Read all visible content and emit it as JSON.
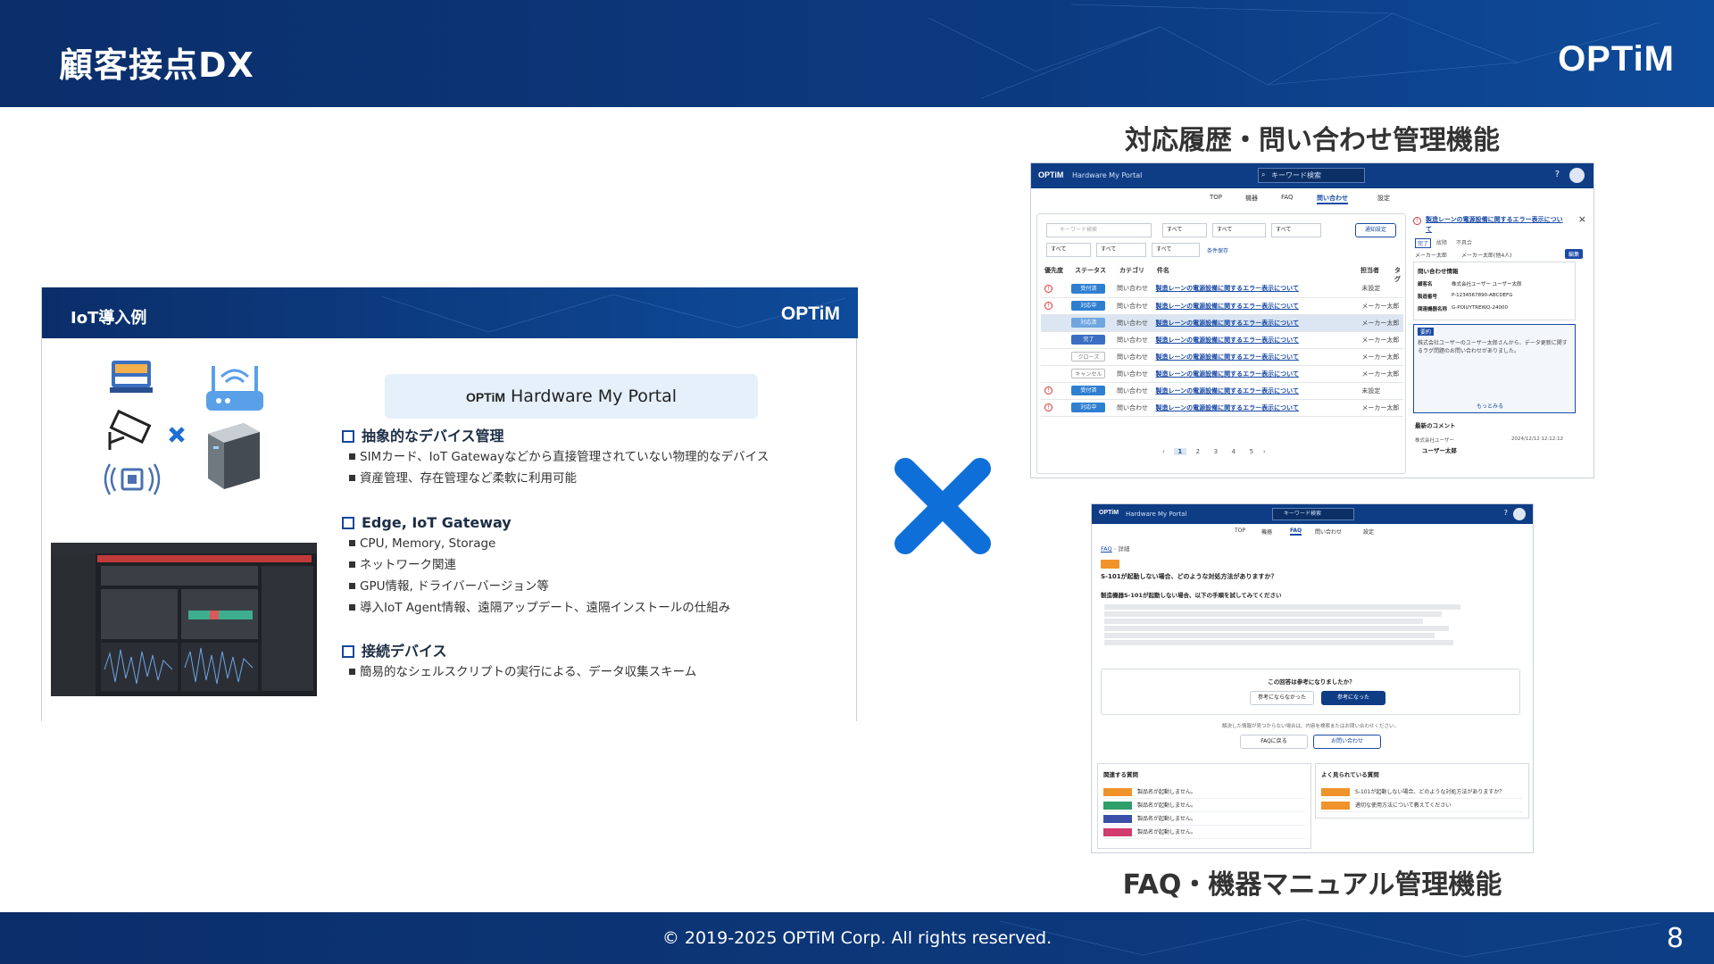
{
  "header": {
    "title": "顧客接点DX",
    "logo": "OPTiM"
  },
  "footer": {
    "copyright": "© 2019-2025 OPTiM Corp. All rights reserved.",
    "page": "8"
  },
  "iot": {
    "title": "IoT導入例",
    "logo": "OPTiM",
    "portal_logo": "OPTiM",
    "portal_name": "Hardware My Portal",
    "sections": [
      {
        "heading": "抽象的なデバイス管理",
        "items": [
          "SIMカード、IoT Gatewayなどから直接管理されていない物理的なデバイス",
          "資産管理、存在管理など柔軟に利用可能"
        ]
      },
      {
        "heading": "Edge, IoT Gateway",
        "items": [
          "CPU, Memory, Storage",
          "ネットワーク関連",
          "GPU情報, ドライバーバージョン等",
          "導入IoT Agent情報、遠隔アップデート、遠隔インストールの仕組み"
        ]
      },
      {
        "heading": "接続デバイス",
        "items": [
          "簡易的なシェルスクリプトの実行による、データ収集スキーム"
        ]
      }
    ]
  },
  "shot1": {
    "caption": "対応履歴・問い合わせ管理機能",
    "app_name": "Hardware My Portal",
    "search_placeholder": "キーワード検索",
    "nav": [
      "TOP",
      "機器",
      "FAQ",
      "問い合わせ",
      "設定"
    ],
    "filter_placeholder": "キーワード検索",
    "filter_default": "すべて",
    "notify_button": "通知設定",
    "save_condition": "条件保存",
    "columns": [
      "優先度",
      "ステータス",
      "カテゴリ",
      "件名",
      "担当者",
      "タグ"
    ],
    "rows": [
      {
        "status": "受付済",
        "color": "#2f7fd1",
        "cat": "問い合わせ",
        "title": "製造レーンの電源設備に関するエラー表示について",
        "owner": "未設定",
        "prio": true
      },
      {
        "status": "対応中",
        "color": "#2f7fd1",
        "cat": "問い合わせ",
        "title": "製造レーンの電源設備に関するエラー表示について",
        "owner": "メーカー太郎",
        "prio": true
      },
      {
        "status": "対応済",
        "color": "#6fa6e0",
        "cat": "問い合わせ",
        "title": "製造レーンの電源設備に関するエラー表示について",
        "owner": "メーカー太郎",
        "prio": false
      },
      {
        "status": "完了",
        "color": "#3b6ec2",
        "cat": "問い合わせ",
        "title": "製造レーンの電源設備に関するエラー表示について",
        "owner": "メーカー太郎",
        "prio": false
      },
      {
        "status": "クローズ",
        "color": "#9aa3ad",
        "cat": "問い合わせ",
        "title": "製造レーンの電源設備に関するエラー表示について",
        "owner": "メーカー太郎",
        "prio": false
      },
      {
        "status": "キャンセル",
        "color": "#9aa3ad",
        "cat": "問い合わせ",
        "title": "製造レーンの電源設備に関するエラー表示について",
        "owner": "メーカー太郎",
        "prio": false
      },
      {
        "status": "受付済",
        "color": "#2f7fd1",
        "cat": "問い合わせ",
        "title": "製造レーンの電源設備に関するエラー表示について",
        "owner": "未設定",
        "prio": true
      },
      {
        "status": "対応中",
        "color": "#2f7fd1",
        "cat": "問い合わせ",
        "title": "製造レーンの電源設備に関するエラー表示について",
        "owner": "メーカー太郎",
        "prio": true
      }
    ],
    "pages": [
      "1",
      "2",
      "3",
      "4",
      "5"
    ],
    "detail": {
      "title": "製造レーンの電源設備に関するエラー表示について",
      "tags": [
        "完了",
        "故障",
        "不具合"
      ],
      "assignee": "メーカー太郎",
      "watcher": "メーカー太郎(他4人)",
      "edit": "編集",
      "info_title": "問い合わせ情報",
      "info": [
        [
          "顧客名",
          "株式会社ユーザー ユーザー太郎"
        ],
        [
          "製造番号",
          "P-1234567890-ABCDEFG"
        ],
        [
          "関連機器名称",
          "G-POIUYTREWQ-24000"
        ]
      ],
      "summary_label": "要約",
      "summary": "株式会社ユーザーのユーザー太郎さんから、データ更新に関するラグ問題のお問い合わせがありました。",
      "more": "もっとみる",
      "comment_title": "最新のコメント",
      "comment_company": "株式会社ユーザー",
      "comment_date": "2024/12/12 12:12:12",
      "comment_user": "ユーザー太郎"
    }
  },
  "shot2": {
    "caption": "FAQ・機器マニュアル管理機能",
    "app_name": "Hardware My Portal",
    "search_placeholder": "キーワード検索",
    "nav": [
      "TOP",
      "機器",
      "FAQ",
      "問い合わせ",
      "設定"
    ],
    "breadcrumb": [
      "FAQ",
      "詳細"
    ],
    "question": "S-101が起動しない場合、どのような対処方法がありますか？",
    "answer_title": "製造機器S-101が起動しない場合、以下の手順を試してみてください",
    "helpful_q": "この回答は参考になりましたか？",
    "not_helpful": "参考にならなかった",
    "helpful": "参考になった",
    "note": "解決した情報が見つからない場合は、内容を検索またはお問い合わせください。",
    "back": "FAQに戻る",
    "contact": "お問い合わせ",
    "related_title": "関連する質問",
    "related": [
      "製品名が起動しません。",
      "製品名が起動しません。",
      "製品名が起動しません。",
      "製品名が起動しません。"
    ],
    "popular_title": "よく見られている質問",
    "popular": [
      "S-101が起動しない場合、どのような対処方法がありますか？",
      "適切な使用方法について教えてください"
    ]
  },
  "colors": {
    "brand": "#0c3a80",
    "accent_x": "#0e6fd9",
    "link": "#1a4aa5"
  }
}
